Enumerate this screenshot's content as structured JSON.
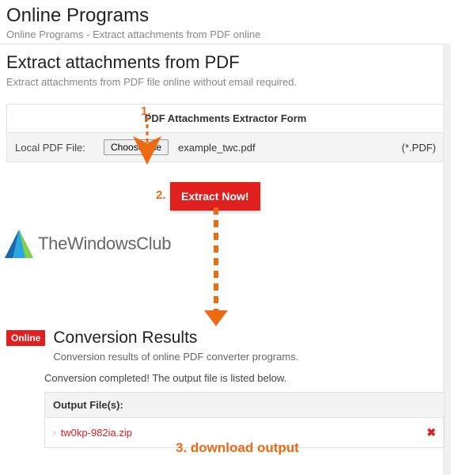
{
  "colors": {
    "accent_red": "#e01f1f",
    "anno_orange": "#ee6a12"
  },
  "header": {
    "title": "Online Programs",
    "breadcrumb": "Online Programs - Extract attachments from PDF online"
  },
  "section": {
    "heading": "Extract attachments from PDF",
    "sub": "Extract attachments from PDF file online without email required."
  },
  "form": {
    "title": "PDF Attachments Extractor Form",
    "label": "Local PDF File:",
    "choose_btn": "Choose File",
    "file_name": "example_twc.pdf",
    "ext_hint": "(*.PDF)"
  },
  "extract_btn": "Extract Now!",
  "watermark": "TheWindowsClub",
  "results": {
    "badge": "Online",
    "heading": "Conversion Results",
    "sub": "Conversion results of online PDF converter programs.",
    "status": "Conversion completed! The output file is listed below.",
    "output_head": "Output File(s):",
    "download_name": "tw0kp-982ia.zip"
  },
  "annotations": {
    "step1": "1.",
    "step2": "2.",
    "step3": "3. download output"
  }
}
